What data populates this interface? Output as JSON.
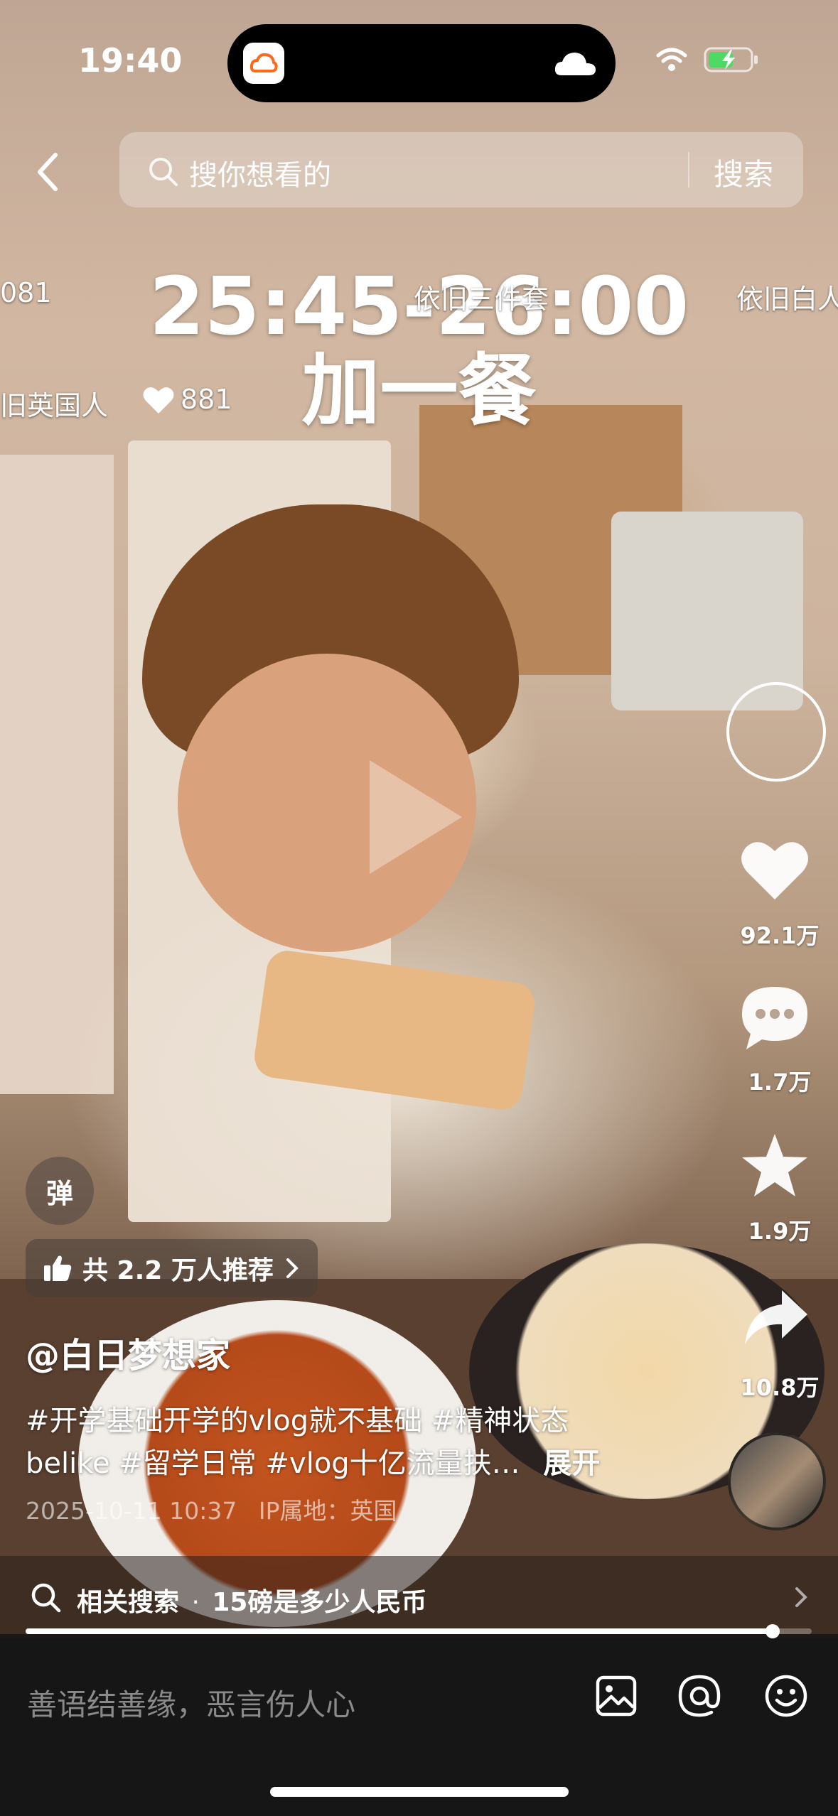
{
  "status_bar": {
    "time": "19:40",
    "battery_charging": true
  },
  "search": {
    "placeholder": "搜你想看的",
    "button": "搜索"
  },
  "video_overlay": {
    "line1": "25:45-26:00",
    "line2": "加一餐"
  },
  "danmaku": [
    {
      "text": "081"
    },
    {
      "text": "依旧三件套"
    },
    {
      "text": "依旧白人"
    },
    {
      "text": "旧英国人"
    },
    {
      "text": "881"
    }
  ],
  "actions": {
    "likes": "92.1万",
    "comments": "1.7万",
    "favorites": "1.9万",
    "shares": "10.8万"
  },
  "danmaku_toggle": "弹",
  "recommend": {
    "text": "共 2.2 万人推荐"
  },
  "post": {
    "author": "@白日梦想家",
    "description": "#开学基础开学的vlog就不基础 #精神状态belike #留学日常 #vlog十亿流量扶…",
    "expand": "展开",
    "date": "2025-10-11 10:37",
    "ip": "IP属地：英国"
  },
  "related_search": {
    "label": "相关搜索",
    "dot": "·",
    "query": "15磅是多少人民币"
  },
  "progress": {
    "fraction": 0.95
  },
  "comment_bar": {
    "placeholder": "善语结善缘，恶言伤人心"
  },
  "icons": {
    "back": "chevron-left-icon",
    "search": "search-icon",
    "like": "heart-icon",
    "comment": "speech-bubble-icon",
    "favorite": "star-icon",
    "share": "share-arrow-icon",
    "play": "play-icon",
    "thumb": "thumbs-up-icon",
    "image": "image-icon",
    "at": "at-icon",
    "emoji": "emoji-icon"
  },
  "colors": {
    "accent_battery": "#4cd964",
    "background": "#161616"
  }
}
